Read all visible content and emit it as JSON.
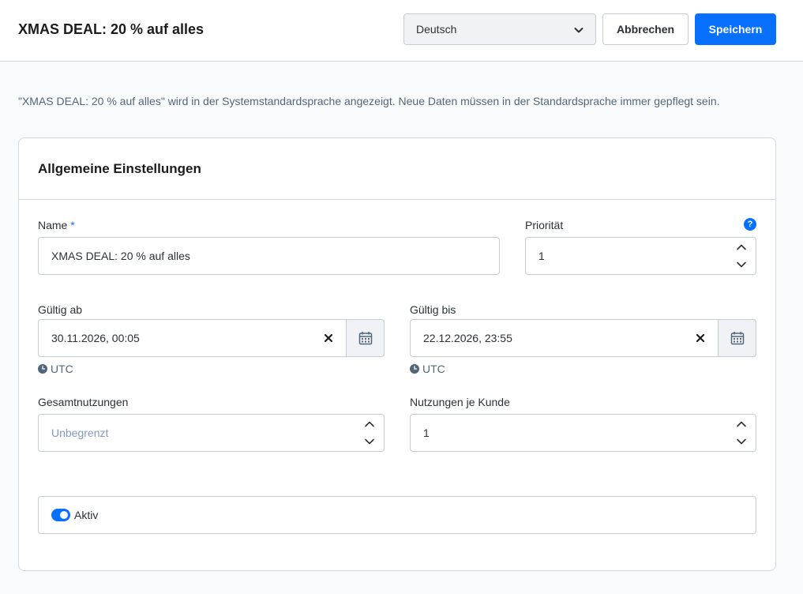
{
  "header": {
    "title": "XMAS DEAL: 20 % auf alles",
    "language_select": "Deutsch",
    "cancel_label": "Abbrechen",
    "save_label": "Speichern",
    "accent_color": "#0870ff"
  },
  "info_text": "\"XMAS DEAL: 20 % auf alles\" wird in der Systemstandardsprache angezeigt. Neue Daten müssen in der Standardsprache immer gepflegt sein.",
  "card": {
    "title": "Allgemeine Einstellungen",
    "name": {
      "label": "Name",
      "required_mark": "*",
      "value": "XMAS DEAL: 20 % auf alles"
    },
    "priority": {
      "label": "Priorität",
      "help_icon": "?",
      "value": "1"
    },
    "valid_from": {
      "label": "Gültig ab",
      "value": "30.11.2026, 00:05",
      "timezone": "UTC"
    },
    "valid_until": {
      "label": "Gültig bis",
      "value": "22.12.2026, 23:55",
      "timezone": "UTC"
    },
    "total_uses": {
      "label": "Gesamtnutzungen",
      "placeholder": "Unbegrenzt"
    },
    "uses_per_customer": {
      "label": "Nutzungen je Kunde",
      "value": "1"
    },
    "active": {
      "label": "Aktiv",
      "checked": true
    }
  }
}
